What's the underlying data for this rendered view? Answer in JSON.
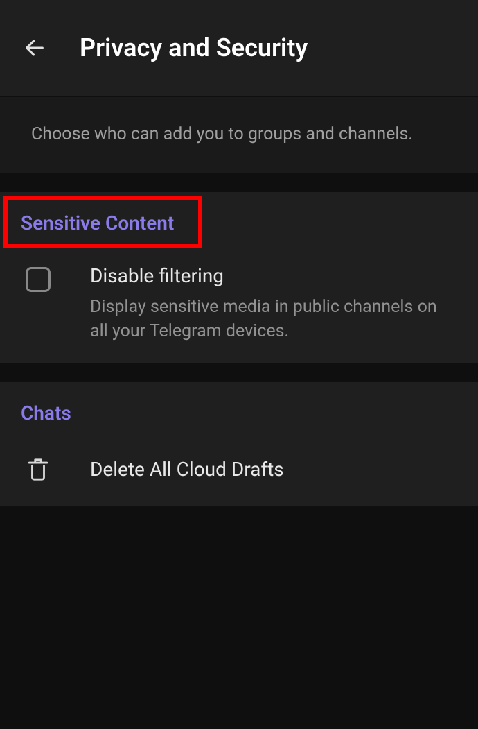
{
  "header": {
    "title": "Privacy and Security"
  },
  "info": {
    "text": "Choose who can add you to groups and channels."
  },
  "sections": {
    "sensitive": {
      "header": "Sensitive Content",
      "disable_filtering": {
        "title": "Disable filtering",
        "subtitle": "Display sensitive media in public channels on all your Telegram devices."
      }
    },
    "chats": {
      "header": "Chats",
      "delete_drafts": {
        "title": "Delete All Cloud Drafts"
      }
    }
  }
}
